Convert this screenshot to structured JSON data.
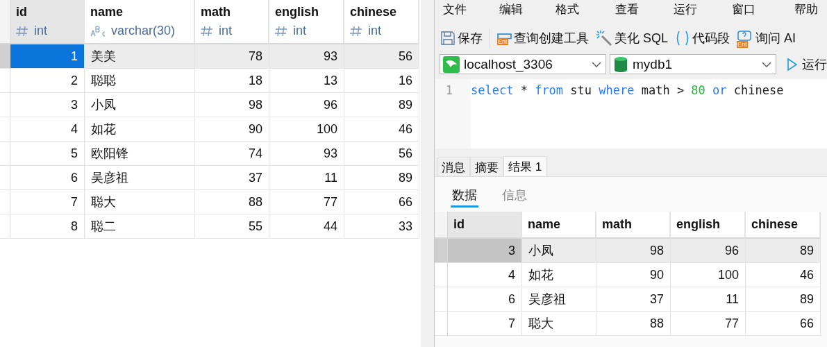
{
  "left_table": {
    "columns": [
      {
        "name": "id",
        "type": "int",
        "kind": "number"
      },
      {
        "name": "name",
        "type": "varchar(30)",
        "kind": "text"
      },
      {
        "name": "math",
        "type": "int",
        "kind": "number"
      },
      {
        "name": "english",
        "type": "int",
        "kind": "number"
      },
      {
        "name": "chinese",
        "type": "int",
        "kind": "number"
      }
    ],
    "rows": [
      {
        "cells": [
          "1",
          "美美",
          "78",
          "93",
          "56"
        ],
        "selected": true
      },
      {
        "cells": [
          "2",
          "聪聪",
          "18",
          "13",
          "16"
        ],
        "selected": false
      },
      {
        "cells": [
          "3",
          "小凤",
          "98",
          "96",
          "89"
        ],
        "selected": false
      },
      {
        "cells": [
          "4",
          "如花",
          "90",
          "100",
          "46"
        ],
        "selected": false
      },
      {
        "cells": [
          "5",
          "欧阳锋",
          "74",
          "93",
          "56"
        ],
        "selected": false
      },
      {
        "cells": [
          "6",
          "吴彦祖",
          "37",
          "11",
          "89"
        ],
        "selected": false
      },
      {
        "cells": [
          "7",
          "聪大",
          "88",
          "77",
          "66"
        ],
        "selected": false
      },
      {
        "cells": [
          "8",
          "聪二",
          "55",
          "44",
          "33"
        ],
        "selected": false
      }
    ]
  },
  "menu": [
    "文件",
    "编辑",
    "格式",
    "查看",
    "运行",
    "窗口",
    "帮助"
  ],
  "toolbar": [
    {
      "label": "保存"
    },
    {
      "label": "查询创建工具",
      "badge": "Ent"
    },
    {
      "label": "美化 SQL"
    },
    {
      "label": "代码段"
    },
    {
      "label": "询问 AI",
      "badge": "Ent"
    }
  ],
  "connection": {
    "value": "localhost_3306"
  },
  "database": {
    "value": "mydb1"
  },
  "run_button": {
    "label": "运行"
  },
  "editor": {
    "line_number": "1",
    "tokens": [
      {
        "text": "select",
        "kind": "keyword"
      },
      {
        "text": " * ",
        "kind": "plain"
      },
      {
        "text": "from",
        "kind": "keyword"
      },
      {
        "text": " stu ",
        "kind": "plain"
      },
      {
        "text": "where",
        "kind": "keyword"
      },
      {
        "text": " math > ",
        "kind": "plain"
      },
      {
        "text": "80",
        "kind": "number"
      },
      {
        "text": " or",
        "kind": "keyword"
      },
      {
        "text": " chinese",
        "kind": "plain"
      }
    ]
  },
  "result_tabs": [
    {
      "label": "消息",
      "selected": false
    },
    {
      "label": "摘要",
      "selected": false
    },
    {
      "label": "结果 1",
      "selected": true
    }
  ],
  "sub_tabs": [
    {
      "label": "数据",
      "selected": true
    },
    {
      "label": "信息",
      "selected": false
    }
  ],
  "result_table": {
    "columns": [
      {
        "name": "id",
        "kind": "number"
      },
      {
        "name": "name",
        "kind": "text"
      },
      {
        "name": "math",
        "kind": "number"
      },
      {
        "name": "english",
        "kind": "number"
      },
      {
        "name": "chinese",
        "kind": "number"
      }
    ],
    "rows": [
      {
        "cells": [
          "3",
          "小凤",
          "98",
          "96",
          "89"
        ],
        "selected": true
      },
      {
        "cells": [
          "4",
          "如花",
          "90",
          "100",
          "46"
        ],
        "selected": false
      },
      {
        "cells": [
          "6",
          "吴彦祖",
          "37",
          "11",
          "89"
        ],
        "selected": false
      },
      {
        "cells": [
          "7",
          "聪大",
          "88",
          "77",
          "66"
        ],
        "selected": false
      }
    ]
  }
}
